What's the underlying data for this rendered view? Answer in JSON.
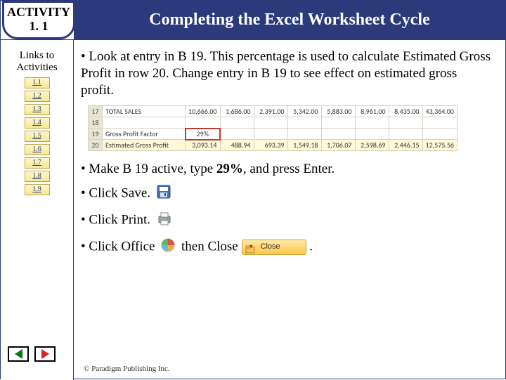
{
  "header": {
    "activity_label": "ACTIVITY",
    "activity_num": "1. 1",
    "title": "Completing the Excel Worksheet Cycle"
  },
  "sidebar": {
    "title_l1": "Links to",
    "title_l2": "Activities",
    "items": [
      {
        "label": "1.1"
      },
      {
        "label": "1.2"
      },
      {
        "label": "1.3"
      },
      {
        "label": "1.4"
      },
      {
        "label": "1.5"
      },
      {
        "label": "1.6"
      },
      {
        "label": "1.7"
      },
      {
        "label": "1.8"
      },
      {
        "label": "1.9"
      }
    ]
  },
  "bullets": {
    "b1": "• Look at entry in B 19. This percentage is used to calculate Estimated Gross Profit in row 20. Change entry in B 19 to see effect on estimated gross profit.",
    "b2_pre": "• Make B 19 active, type ",
    "b2_bold": "29%",
    "b2_post": ", and press Enter.",
    "b3": "• Click Save.",
    "b4": "• Click Print.",
    "b5_pre": "• Click Office ",
    "b5_mid": " then Close ",
    "b5_post": " ."
  },
  "excel": {
    "rows": [
      {
        "rh": "17",
        "label": "TOTAL SALES",
        "cells": [
          "10,666.00",
          "1,686.00",
          "2,391.00",
          "5,342.00",
          "5,883.00",
          "8,961.00",
          "8,435.00",
          "43,364.00"
        ],
        "style": ""
      },
      {
        "rh": "18",
        "label": "",
        "cells": [
          "",
          "",
          "",
          "",
          "",
          "",
          "",
          ""
        ],
        "style": ""
      },
      {
        "rh": "19",
        "label": "Gross Profit Factor",
        "cells": [
          "29%",
          "",
          "",
          "",
          "",
          "",
          "",
          ""
        ],
        "style": "highlight"
      },
      {
        "rh": "20",
        "label": "Estimated Gross Profit",
        "cells": [
          "3,093.14",
          "488.94",
          "693.39",
          "1,549.18",
          "1,706.07",
          "2,598.69",
          "2,446.15",
          "12,575.56"
        ],
        "style": "ybottom"
      }
    ]
  },
  "close_btn": {
    "label": "Close"
  },
  "footer": "© Paradigm Publishing Inc.",
  "icons": {
    "save": "save-icon",
    "print": "print-icon",
    "office": "office-icon",
    "close": "close-folder-icon"
  }
}
